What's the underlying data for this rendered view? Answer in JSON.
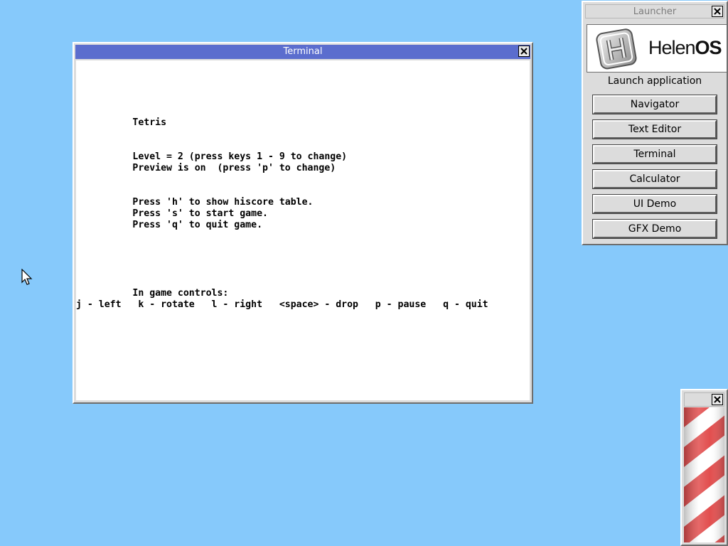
{
  "terminal": {
    "title": "Terminal",
    "lines": [
      "          Tetris",
      "          Level = 2 (press keys 1 - 9 to change)",
      "          Preview is on  (press 'p' to change)",
      "          Press 'h' to show hiscore table.",
      "          Press 's' to start game.",
      "          Press 'q' to quit game.",
      "          In game controls:",
      "j - left   k - rotate   l - right   <space> - drop   p - pause   q - quit"
    ]
  },
  "launcher": {
    "title": "Launcher",
    "logo_text_a": "Helen",
    "logo_text_b": "OS",
    "subtitle": "Launch application",
    "buttons": [
      "Navigator",
      "Text Editor",
      "Terminal",
      "Calculator",
      "UI Demo",
      "GFX Demo"
    ]
  },
  "colors": {
    "desktop": "#86c9fb",
    "active_title": "#5b6dce",
    "pole_red": "#e04848",
    "pole_white": "#ffffff"
  }
}
